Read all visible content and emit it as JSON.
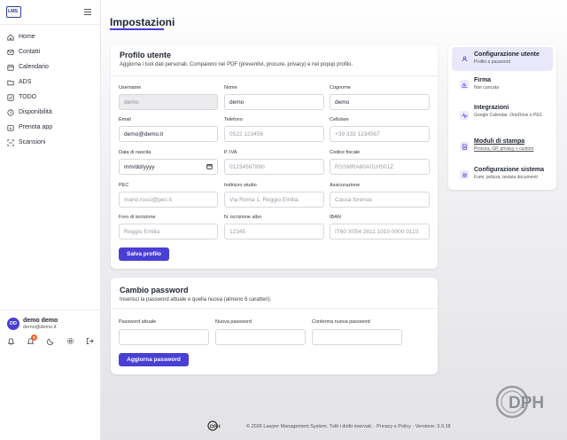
{
  "app": {
    "logo_text": "LMS"
  },
  "sidebar": {
    "items": [
      {
        "label": "Home",
        "icon": "home-icon"
      },
      {
        "label": "Contatti",
        "icon": "mail-icon"
      },
      {
        "label": "Calendario",
        "icon": "calendar-icon"
      },
      {
        "label": "ADS",
        "icon": "folder-icon"
      },
      {
        "label": "TODO",
        "icon": "checkbox-icon"
      },
      {
        "label": "Disponibilità",
        "icon": "clock-icon"
      },
      {
        "label": "Prenota app",
        "icon": "calendar-plus-icon"
      },
      {
        "label": "Scansioni",
        "icon": "scan-icon"
      }
    ],
    "user": {
      "initials": "DD",
      "name": "demo demo",
      "email": "demo@demo.it",
      "notification_count": "6"
    }
  },
  "page": {
    "title": "Impostazioni"
  },
  "profile": {
    "title": "Profilo utente",
    "subtitle": "Aggiorna i tuoi dati personali. Compaiono nei PDF (preventivi, procure, privacy) e nei popup profilo.",
    "fields": {
      "username": {
        "label": "Username",
        "value": "demo"
      },
      "nome": {
        "label": "Nome",
        "value": "demo"
      },
      "cognome": {
        "label": "Cognome",
        "value": "demo"
      },
      "email": {
        "label": "Email",
        "value": "demo@demo.it"
      },
      "telefono": {
        "label": "Telefono",
        "placeholder": "0522 123456"
      },
      "cellulare": {
        "label": "Cellulare",
        "placeholder": "+39 333 1234567"
      },
      "data_nascita": {
        "label": "Data di nascita",
        "placeholder": "mm/dd/yyyy"
      },
      "piva": {
        "label": "P. IVA",
        "placeholder": "01234567890"
      },
      "codice_fiscale": {
        "label": "Codice fiscale",
        "placeholder": "RSSMRA80A01H501Z"
      },
      "pec": {
        "label": "PEC",
        "placeholder": "mario.rossi@pec.it"
      },
      "indirizzo": {
        "label": "Indirizzo studio",
        "placeholder": "Via Roma 1, Reggio Emilia"
      },
      "assicurazione": {
        "label": "Assicurazione",
        "placeholder": "Cassa forense"
      },
      "foro": {
        "label": "Foro di iscrizione",
        "placeholder": "Reggio Emilia"
      },
      "n_iscrizione": {
        "label": "N. iscrizione albo",
        "placeholder": "12345"
      },
      "iban": {
        "label": "IBAN",
        "placeholder": "IT60 X054 2811 1010 0000 0123"
      }
    },
    "save_label": "Salva profilo"
  },
  "password": {
    "title": "Cambio password",
    "subtitle": "Inserisci la password attuale e quella nuova (almeno 6 caratteri).",
    "current_label": "Password attuale",
    "new_label": "Nuova password",
    "confirm_label": "Conferma nuova password",
    "button_label": "Aggiorna password"
  },
  "settings_menu": [
    {
      "title": "Configurazione utente",
      "subtitle": "Profilo e password",
      "icon": "user-icon"
    },
    {
      "title": "Firma",
      "subtitle": "Non caricata",
      "icon": "signature-icon"
    },
    {
      "title": "Integrazioni",
      "subtitle": "Google Calendar, OneDrive e PEC",
      "icon": "pulse-icon"
    },
    {
      "title": "Moduli di stampa",
      "subtitle": "Procura, GP, privacy + custom",
      "icon": "document-icon"
    },
    {
      "title": "Configurazione sistema",
      "subtitle": "Fumi, polizza, testata documenti",
      "icon": "gear-icon"
    }
  ],
  "footer": {
    "text": "© 2026 Lawyer Management System. Tutti i diritti riservati. · Privacy e Policy · Versione: 3.9.18"
  },
  "colors": {
    "accent": "#4a3fd4",
    "badge": "#f0622c"
  }
}
